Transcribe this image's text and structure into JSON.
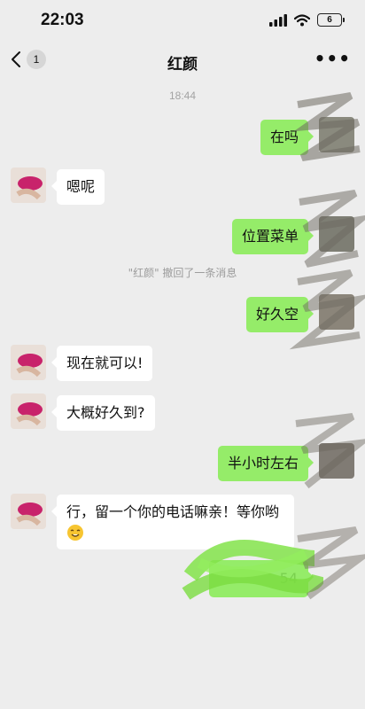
{
  "status_bar": {
    "time": "22:03",
    "battery": "6"
  },
  "nav": {
    "back_count": "1",
    "title": "红颜"
  },
  "chat": {
    "timestamp": "18:44",
    "recall_notice": "\"红颜\" 撤回了一条消息",
    "messages": [
      {
        "from": "me",
        "text": "在吗"
      },
      {
        "from": "contact",
        "text": "嗯呢"
      },
      {
        "from": "me",
        "text": "位置菜单"
      },
      {
        "from": "me",
        "text": "好久空"
      },
      {
        "from": "contact",
        "text": "现在就可以!"
      },
      {
        "from": "contact",
        "text": "大概好久到?"
      },
      {
        "from": "me",
        "text": "半小时左右"
      },
      {
        "from": "contact",
        "text": "行，留一个你的电话嘛亲！等你哟"
      }
    ],
    "last_redacted_text": "54"
  },
  "icons": [
    "signal-icon",
    "wifi-icon",
    "battery-icon",
    "back-chevron-icon",
    "more-icon",
    "smile-emoji-icon"
  ],
  "colors": {
    "background": "#ededed",
    "outgoing_bubble": "#95ec69",
    "incoming_bubble": "#ffffff"
  }
}
